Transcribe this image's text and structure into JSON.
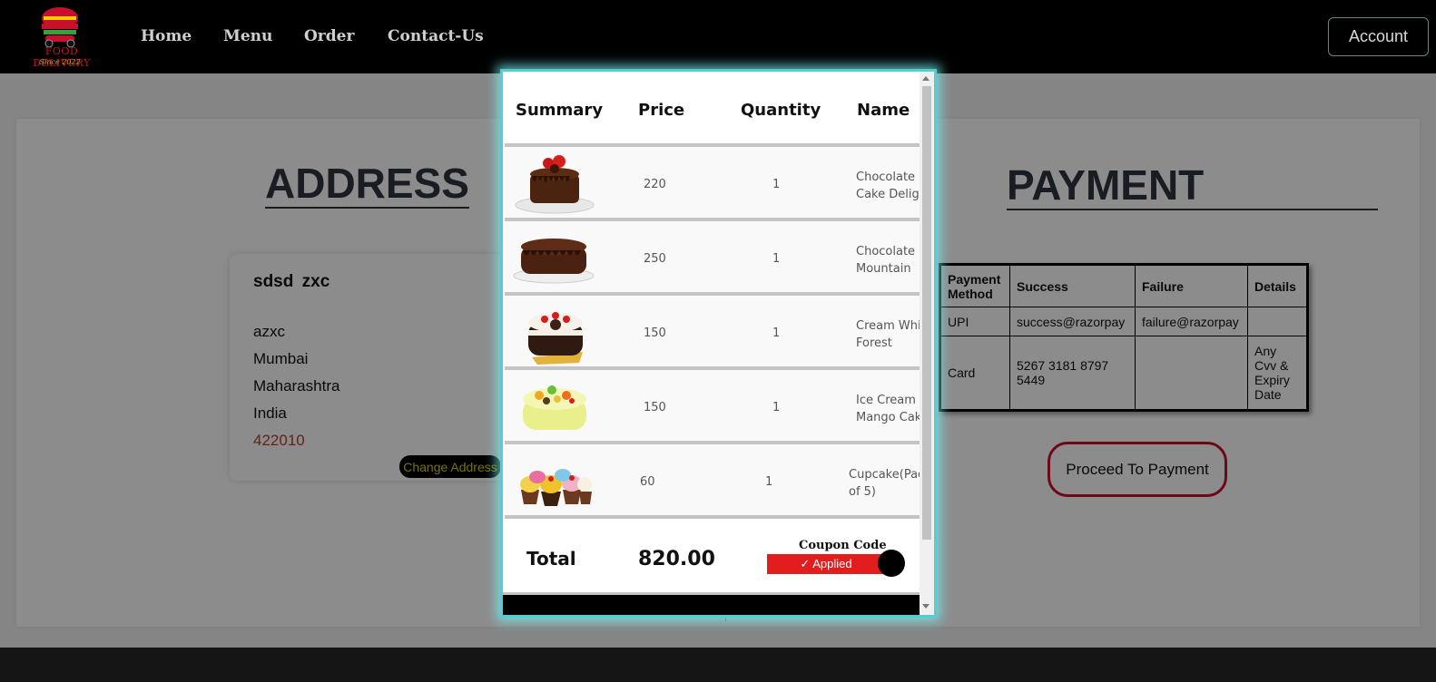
{
  "brand": {
    "logo_text": "FOOD DELIVERY",
    "since": "Since 2022"
  },
  "nav": {
    "links": [
      "Home",
      "Menu",
      "Order",
      "Contact-Us"
    ],
    "account": "Account"
  },
  "address": {
    "heading": "ADDRESS",
    "name": "sdsd  zxc",
    "lines": [
      "azxc",
      "Mumbai",
      "Maharashtra",
      "India"
    ],
    "pincode": "422010",
    "change_button": "Change Address"
  },
  "payment": {
    "heading": "PAYMENT",
    "table": {
      "headers": [
        "Payment Method",
        "Success",
        "Failure",
        "Details"
      ],
      "rows": [
        [
          "UPI",
          "success@razorpay",
          "failure@razorpay",
          ""
        ],
        [
          "Card",
          "5267 3181 8797 5449",
          "",
          "Any Cvv & Expiry Date"
        ]
      ]
    },
    "proceed_button": "Proceed To Payment"
  },
  "summary": {
    "headers": {
      "summary": "Summary",
      "price": "Price",
      "quantity": "Quantity",
      "name": "Name"
    },
    "items": [
      {
        "price": "220",
        "quantity": "1",
        "name_line1": "Chocolate",
        "name_line2": "Cake Deligh",
        "image": "chocolate-drip-cake"
      },
      {
        "price": "250",
        "quantity": "1",
        "name_line1": "Chocolate",
        "name_line2": "Mountain",
        "image": "chocolate-mountain-cake"
      },
      {
        "price": "150",
        "quantity": "1",
        "name_line1": "Cream Whit",
        "name_line2": "Forest",
        "image": "white-forest-cake"
      },
      {
        "price": "150",
        "quantity": "1",
        "name_line1": "Ice Cream",
        "name_line2": "Mango Cak",
        "image": "mango-cake"
      },
      {
        "price": "60",
        "quantity": "1",
        "name_line1": "Cupcake(Pac",
        "name_line2": "of 5)",
        "image": "cupcakes"
      }
    ],
    "total_label": "Total",
    "total_value": "820.00",
    "coupon_label": "Coupon Code",
    "coupon_status": "✓ Applied"
  },
  "colors": {
    "accent_cyan": "#4fd0d4",
    "coupon_red": "#e11d1d",
    "proceed_border": "#c8102e"
  }
}
